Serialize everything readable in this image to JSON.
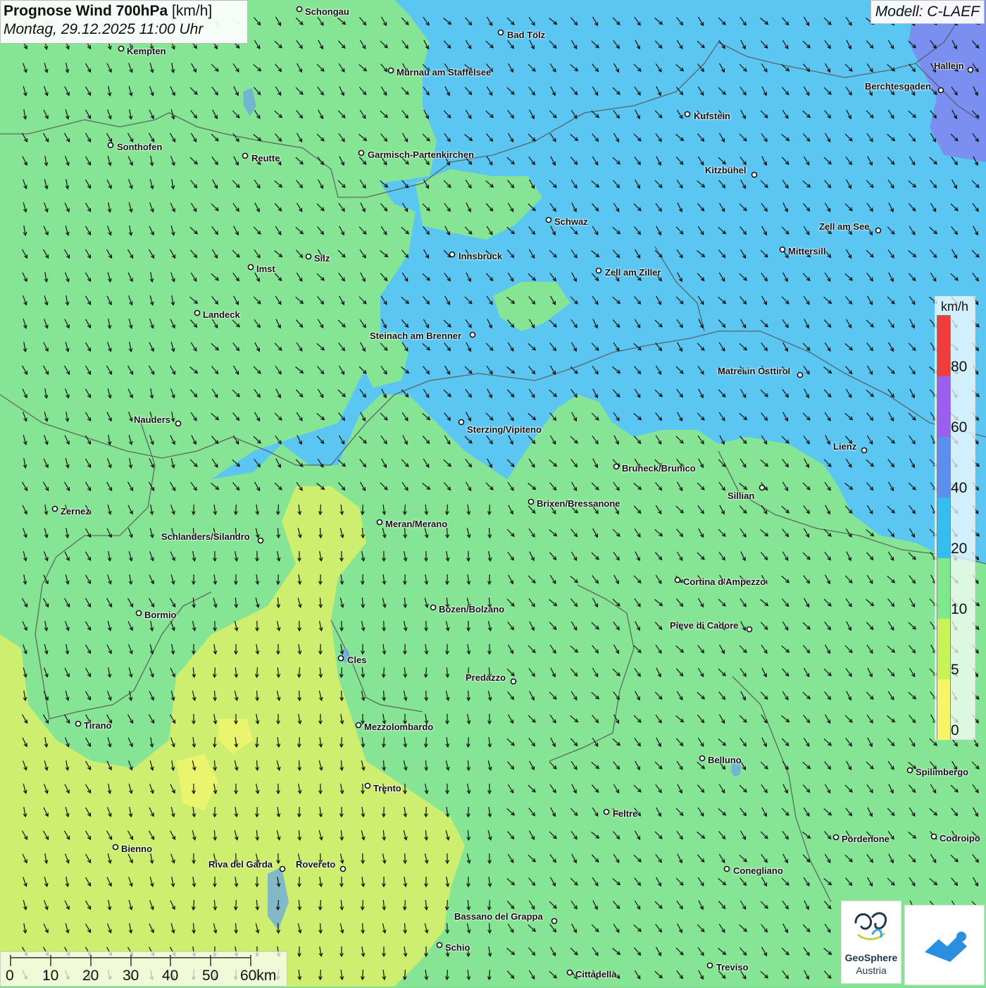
{
  "header": {
    "title_bold": "Prognose Wind 700hPa",
    "title_unit": " [km/h]",
    "datetime": "Montag, 29.12.2025 11:00 Uhr"
  },
  "model": "Modell: C-LAEF",
  "legend": {
    "unit": "km/h",
    "labels": [
      "80",
      "60",
      "40",
      "20",
      "10",
      "5",
      "0"
    ],
    "colors": [
      "#f03c3c",
      "#9b5ff0",
      "#5c8ef0",
      "#33bdf0",
      "#7ee88a",
      "#c8f25a",
      "#f6f56a"
    ]
  },
  "scale": {
    "labels": [
      "0",
      "10",
      "20",
      "30",
      "40",
      "50",
      "60km"
    ]
  },
  "logos": {
    "geosphere_line1": "GeoSphere",
    "geosphere_line2": "Austria"
  },
  "colors": {
    "calm_green": "#86e495",
    "blue_zone": "#5bc6f2",
    "yellow_zone": "#cdee6e",
    "purple_zone": "#7a8ff0"
  },
  "cities": [
    {
      "name": "Schongau"
    },
    {
      "name": "Bad Tölz"
    },
    {
      "name": "Kempten"
    },
    {
      "name": "Murnau am Staffelsee"
    },
    {
      "name": "Hallein"
    },
    {
      "name": "Berchtesgaden"
    },
    {
      "name": "Kufstein"
    },
    {
      "name": "Sonthofen"
    },
    {
      "name": "Reutte"
    },
    {
      "name": "Garmisch-Partenkirchen"
    },
    {
      "name": "Kitzbühel"
    },
    {
      "name": "Schwaz"
    },
    {
      "name": "Zell am See"
    },
    {
      "name": "Innsbruck"
    },
    {
      "name": "Mittersill"
    },
    {
      "name": "Silz"
    },
    {
      "name": "Imst"
    },
    {
      "name": "Zell am Ziller"
    },
    {
      "name": "Landeck"
    },
    {
      "name": "Steinach am Brenner"
    },
    {
      "name": "Matrei in Osttirol"
    },
    {
      "name": "Nauders"
    },
    {
      "name": "Sterzing/Vipiteno"
    },
    {
      "name": "Lienz"
    },
    {
      "name": "Bruneck/Brunico"
    },
    {
      "name": "Sillian"
    },
    {
      "name": "Zernez"
    },
    {
      "name": "Brixen/Bressanone"
    },
    {
      "name": "Meran/Merano"
    },
    {
      "name": "Schlanders/Silandro"
    },
    {
      "name": "Cortina d'Ampezzo"
    },
    {
      "name": "Bozen/Bolzano"
    },
    {
      "name": "Bormio"
    },
    {
      "name": "Pieve di Cadore"
    },
    {
      "name": "Cles"
    },
    {
      "name": "Predazzo"
    },
    {
      "name": "Tirano"
    },
    {
      "name": "Mezzolombardo"
    },
    {
      "name": "Belluno"
    },
    {
      "name": "Spilimbergo"
    },
    {
      "name": "Trento"
    },
    {
      "name": "Feltre"
    },
    {
      "name": "Pordenone"
    },
    {
      "name": "Codroipo"
    },
    {
      "name": "Bienno"
    },
    {
      "name": "Riva del Garda"
    },
    {
      "name": "Rovereto"
    },
    {
      "name": "Conegliano"
    },
    {
      "name": "Bassano del Grappa"
    },
    {
      "name": "Schio"
    },
    {
      "name": "Treviso"
    },
    {
      "name": "Cittadella"
    }
  ]
}
